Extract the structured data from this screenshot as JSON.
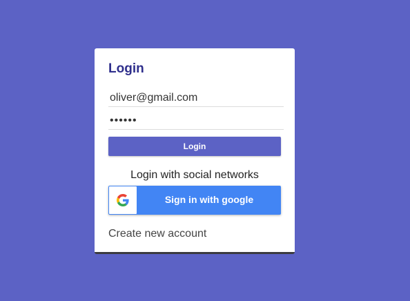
{
  "login_card": {
    "title": "Login",
    "email_value": "oliver@gmail.com",
    "password_value": "••••••",
    "login_button_label": "Login",
    "social_label": "Login with social networks",
    "google_button_label": "Sign in with google",
    "create_account_label": "Create new account"
  },
  "icons": {
    "google": "google-g-icon"
  },
  "colors": {
    "background": "#5c62c5",
    "title": "#2f2f8c",
    "login_button": "#5c62c5",
    "google_button": "#4285f4"
  }
}
